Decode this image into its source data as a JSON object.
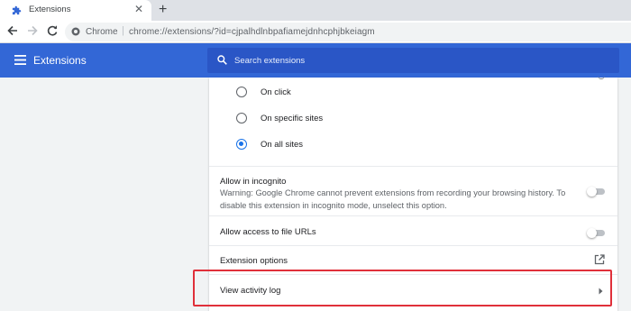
{
  "browser": {
    "tab_title": "Extensions",
    "tab_close": "✕",
    "new_tab": "+",
    "origin_label": "Chrome",
    "separator": "|",
    "url": "chrome://extensions/?id=cjpalhdlnbpafiamejdnhcphjbkeiagm"
  },
  "header": {
    "title": "Extensions",
    "search_placeholder": "Search extensions"
  },
  "site_access": {
    "options": [
      {
        "label": "On click",
        "selected": false
      },
      {
        "label": "On specific sites",
        "selected": false
      },
      {
        "label": "On all sites",
        "selected": true
      }
    ]
  },
  "incognito": {
    "title": "Allow in incognito",
    "description": "Warning: Google Chrome cannot prevent extensions from recording your browsing history. To disable this extension in incognito mode, unselect this option.",
    "enabled": false
  },
  "file_urls": {
    "title": "Allow access to file URLs",
    "enabled": false
  },
  "extension_options": {
    "title": "Extension options"
  },
  "activity_log": {
    "title": "View activity log"
  },
  "colors": {
    "header_blue": "#3367d6",
    "accent": "#1a73e8",
    "highlight_red": "#e0303a"
  }
}
